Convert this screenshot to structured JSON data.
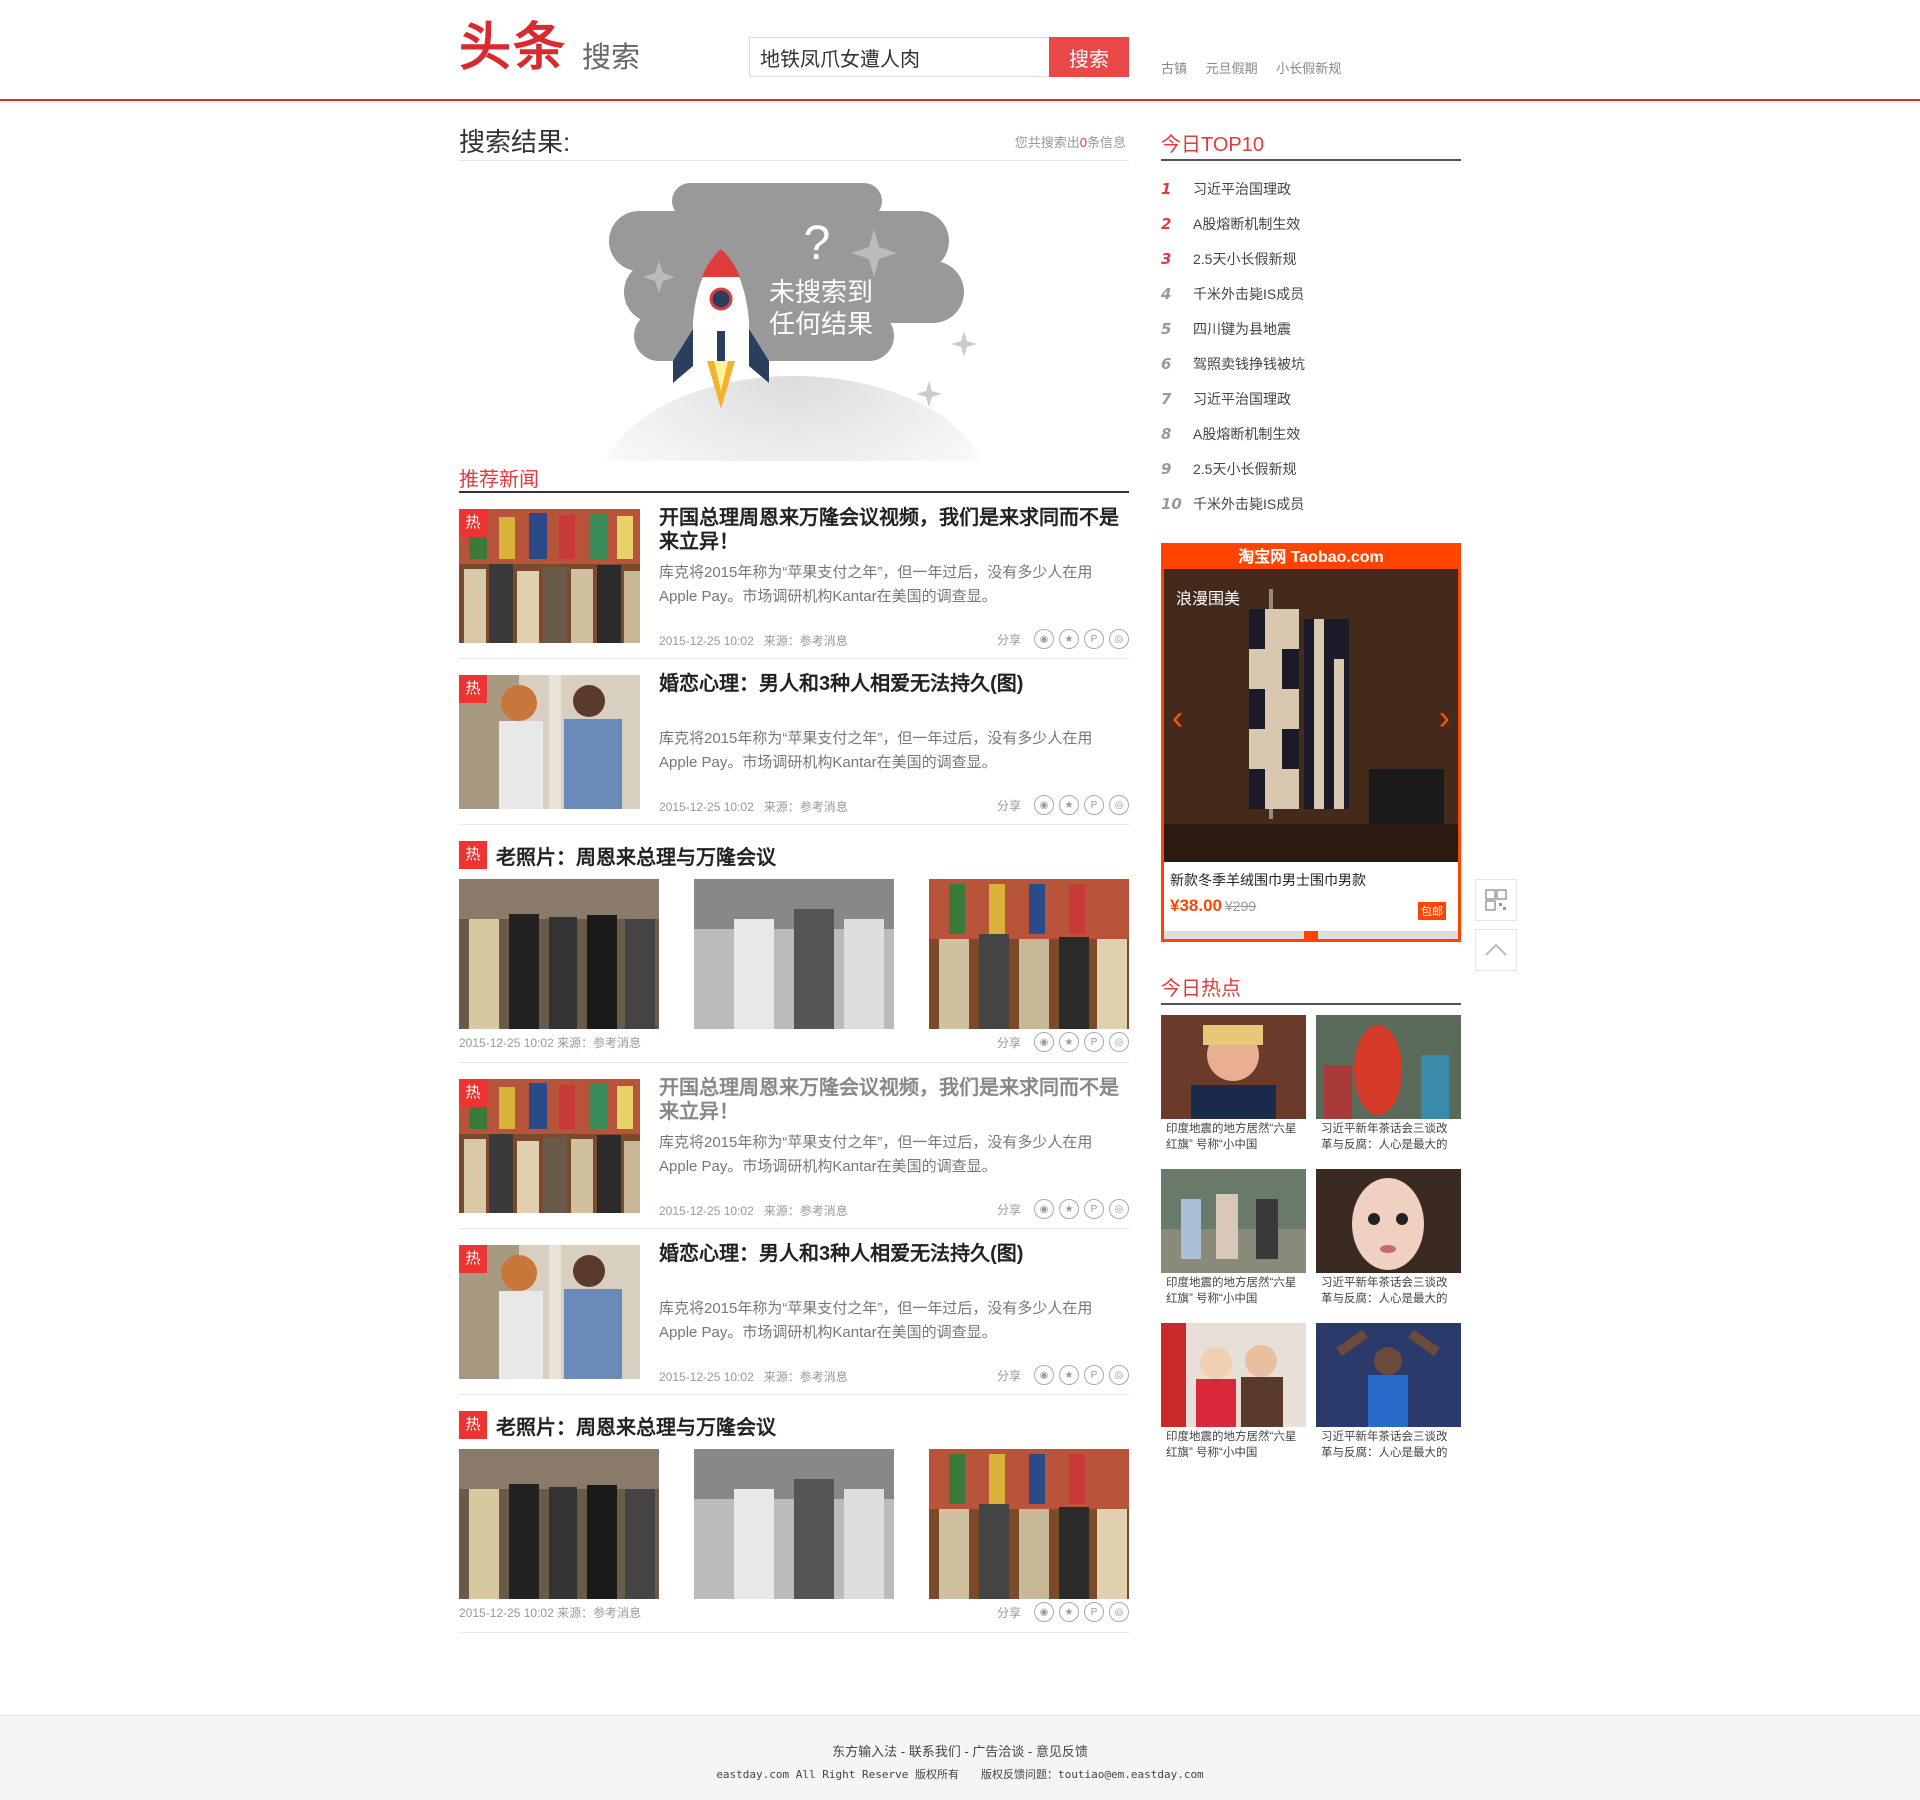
{
  "header": {
    "logo": "头条",
    "logo_sub": "搜索",
    "search_value": "地铁凤爪女遭人肉",
    "search_button": "搜索",
    "hot_words": [
      "古镇",
      "元旦假期",
      "小长假新规"
    ]
  },
  "result": {
    "title": "搜索结果:",
    "count_prefix": "您共搜索出",
    "count": "0",
    "count_suffix": "条信息",
    "empty_line1": "未搜索到",
    "empty_line2": "任何结果",
    "question": "?"
  },
  "recommend_title": "推荐新闻",
  "hot_badge": "热",
  "share_label": "分享",
  "news": [
    {
      "title": "开国总理周恩来万隆会议视频，我们是来求同而不是来立异！",
      "desc": "库克将2015年称为“苹果支付之年”，但一年过后，没有多少人在用 Apple Pay。市场调研机构Kantar在美国的调查显。",
      "date": "2015-12-25 10:02",
      "source": "来源：参考消息"
    },
    {
      "title": "婚恋心理：男人和3种人相爱无法持久(图)",
      "desc": "库克将2015年称为“苹果支付之年”，但一年过后，没有多少人在用 Apple Pay。市场调研机构Kantar在美国的调查显。",
      "date": "2015-12-25 10:02",
      "source": "来源：参考消息"
    },
    {
      "title": "开国总理周恩来万隆会议视频，我们是来求同而不是来立异！",
      "desc": "库克将2015年称为“苹果支付之年”，但一年过后，没有多少人在用 Apple Pay。市场调研机构Kantar在美国的调查显。",
      "date": "2015-12-25 10:02",
      "source": "来源：参考消息"
    },
    {
      "title": "婚恋心理：男人和3种人相爱无法持久(图)",
      "desc": "库克将2015年称为“苹果支付之年”，但一年过后，没有多少人在用 Apple Pay。市场调研机构Kantar在美国的调查显。",
      "date": "2015-12-25 10:02",
      "source": "来源：参考消息"
    }
  ],
  "photo_news": [
    {
      "title": "老照片：周恩来总理与万隆会议",
      "meta": "2015-12-25 10:02 来源：参考消息"
    },
    {
      "title": "老照片：周恩来总理与万隆会议",
      "meta": "2015-12-25 10:02 来源：参考消息"
    }
  ],
  "sidebar": {
    "top_title": "今日TOP10",
    "top_list": [
      {
        "rank": "1",
        "text": "习近平治国理政"
      },
      {
        "rank": "2",
        "text": "A股熔断机制生效"
      },
      {
        "rank": "3",
        "text": "2.5天小长假新规"
      },
      {
        "rank": "4",
        "text": "千米外击毙IS成员"
      },
      {
        "rank": "5",
        "text": "四川键为县地震"
      },
      {
        "rank": "6",
        "text": "驾照卖钱挣钱被坑"
      },
      {
        "rank": "7",
        "text": "习近平治国理政"
      },
      {
        "rank": "8",
        "text": "A股熔断机制生效"
      },
      {
        "rank": "9",
        "text": "2.5天小长假新规"
      },
      {
        "rank": "10",
        "text": "千米外击毙IS成员"
      }
    ],
    "ad": {
      "brand": "淘宝网 Taobao.com",
      "overlay": "浪漫围美",
      "name": "新款冬季羊绒围巾男士围巾男款",
      "price": "¥38.00",
      "old_price": "¥299",
      "tag": "包邮"
    },
    "hot_title": "今日热点",
    "hot_items": [
      {
        "caption": "印度地震的地方居然“六星红旗” 号称“小中国"
      },
      {
        "caption": "习近平新年茶话会三谈改革与反腐：人心是最大的"
      },
      {
        "caption": "印度地震的地方居然“六星红旗” 号称“小中国"
      },
      {
        "caption": "习近平新年茶话会三谈改革与反腐：人心是最大的"
      },
      {
        "caption": "印度地震的地方居然“六星红旗” 号称“小中国"
      },
      {
        "caption": "习近平新年茶话会三谈改革与反腐：人心是最大的"
      }
    ]
  },
  "footer": {
    "links": "东方输入法 - 联系我们 - 广告洽谈 - 意见反馈",
    "copyright": "eastday.com All Right Reserve 版权所有　　版权反馈问题：toutiao@em.eastday.com"
  },
  "colors": {
    "brand_red": "#d92b2f",
    "button_red": "#ea4848",
    "ad_orange": "#ff4400"
  }
}
